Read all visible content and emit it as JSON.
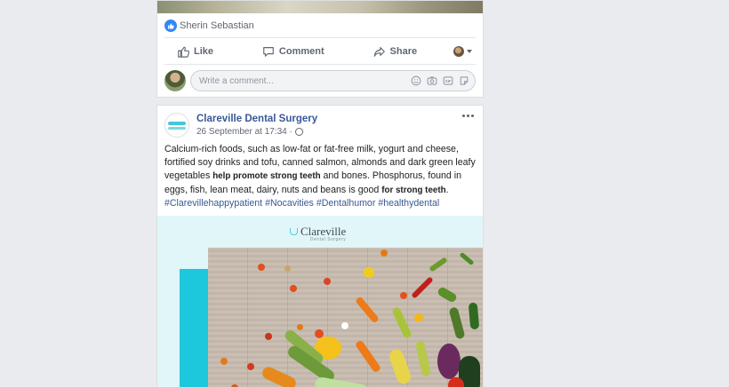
{
  "previous_post": {
    "reaction_name": "Sherin Sebastian",
    "actions": {
      "like": "Like",
      "comment": "Comment",
      "share": "Share"
    },
    "comment_placeholder": "Write a comment..."
  },
  "post": {
    "page_name": "Clareville Dental Surgery",
    "timestamp": "26 September at 17:34 ·",
    "text_parts": {
      "p1": "Calcium-rich foods, such as low-fat or fat-free milk, yogurt and cheese, fortified soy drinks and tofu, canned salmon, almonds and dark green leafy vegetables ",
      "b1": "help promote strong teeth",
      "p2": " and bones. Phosphorus, found in eggs, fish, lean meat, dairy, nuts and beans is good ",
      "b2": "for strong teeth",
      "p3": "."
    },
    "hashtags": [
      "#Clarevillehappypatient",
      "#Nocavities",
      "#Dentalhumor",
      "#healthydental"
    ],
    "image": {
      "brand_name": "Clareville",
      "brand_sub": "Dental Surgery"
    }
  },
  "colors": {
    "link": "#385898",
    "background": "#e9ebee",
    "image_bg": "#e1f6f9",
    "accent_cyan": "#1ec8dc"
  },
  "icons": [
    "like-thumb-icon",
    "comment-bubble-icon",
    "share-arrow-icon",
    "emoji-icon",
    "camera-icon",
    "gif-icon",
    "sticker-icon",
    "globe-icon",
    "more-dots-icon"
  ]
}
